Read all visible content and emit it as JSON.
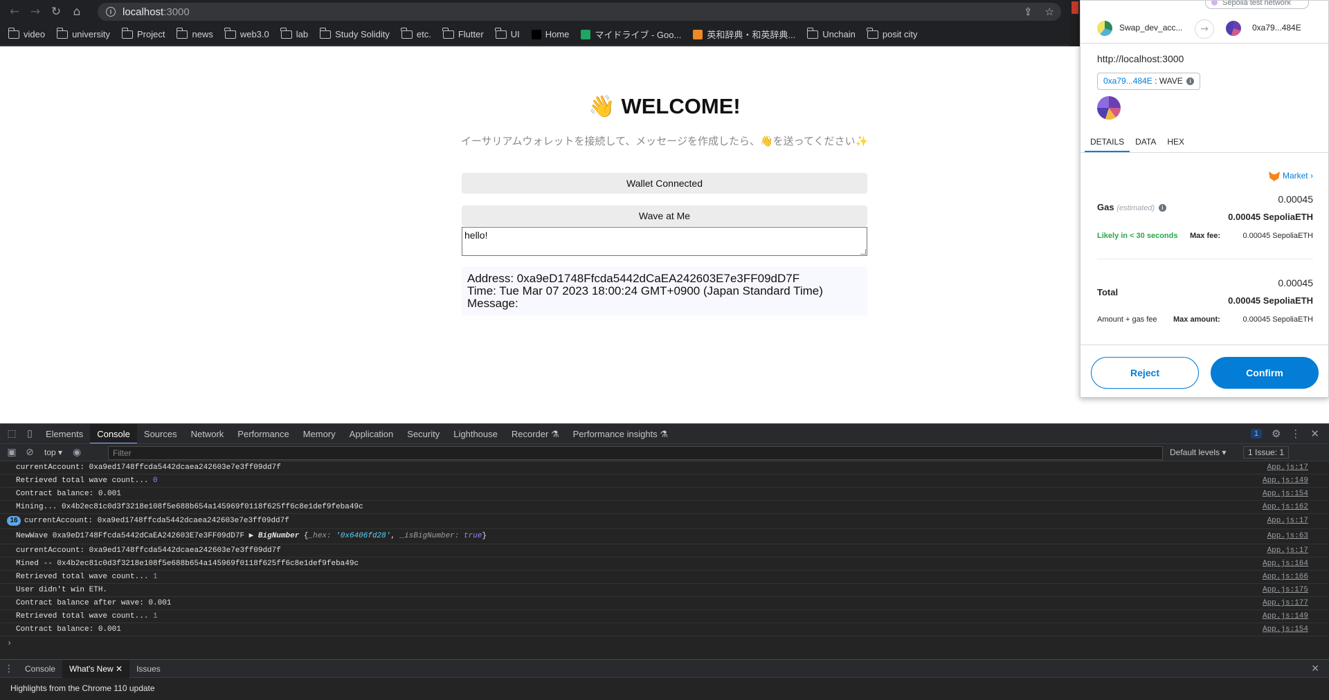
{
  "browser": {
    "url_host": "localhost",
    "url_port": ":3000",
    "bookmarks": [
      {
        "label": "video",
        "type": "folder"
      },
      {
        "label": "university",
        "type": "folder"
      },
      {
        "label": "Project",
        "type": "folder"
      },
      {
        "label": "news",
        "type": "folder"
      },
      {
        "label": "web3.0",
        "type": "folder"
      },
      {
        "label": "lab",
        "type": "folder"
      },
      {
        "label": "Study Solidity",
        "type": "folder"
      },
      {
        "label": "etc.",
        "type": "folder"
      },
      {
        "label": "Flutter",
        "type": "folder"
      },
      {
        "label": "UI",
        "type": "folder"
      },
      {
        "label": "Home",
        "type": "link"
      },
      {
        "label": "マイドライブ - Goo...",
        "type": "link"
      },
      {
        "label": "英和辞典・和英辞典...",
        "type": "link"
      },
      {
        "label": "Unchain",
        "type": "folder"
      },
      {
        "label": "posit city",
        "type": "folder"
      }
    ]
  },
  "page": {
    "welcome": "👋 WELCOME!",
    "subtitle": "イーサリアムウォレットを接続して、メッセージを作成したら、👋を送ってください✨",
    "wallet_button": "Wallet Connected",
    "wave_button": "Wave at Me",
    "message_value": "hello!",
    "wave_card": {
      "address": "Address: 0xa9eD1748Ffcda5442dCaEA242603E7e3FF09dD7F",
      "time": "Time: Tue Mar 07 2023 18:00:24 GMT+0900 (Japan Standard Time)",
      "message": "Message:"
    }
  },
  "devtools": {
    "tabs": [
      "Elements",
      "Console",
      "Sources",
      "Network",
      "Performance",
      "Memory",
      "Application",
      "Security",
      "Lighthouse",
      "Recorder ⚗",
      "Performance insights ⚗"
    ],
    "active_tab": "Console",
    "messages_badge": "1",
    "context": "top ▾",
    "filter_placeholder": "Filter",
    "levels": "Default levels ▾",
    "issues": "1 Issue: 1",
    "logs": [
      {
        "text": "currentAccount:  0xa9ed1748ffcda5442dcaea242603e7e3ff09dd7f",
        "num": "",
        "src": "App.js:17",
        "badge": ""
      },
      {
        "text": "Retrieved total wave count... ",
        "num": "0",
        "src": "App.js:149",
        "badge": ""
      },
      {
        "text": "Contract balance: 0.001",
        "num": "",
        "src": "App.js:154",
        "badge": ""
      },
      {
        "text": "Mining... 0x4b2ec81c0d3f3218e108f5e688b654a145969f0118f625ff6c8e1def9feba49c",
        "num": "",
        "src": "App.js:162",
        "badge": ""
      },
      {
        "text": "currentAccount:  0xa9ed1748ffcda5442dcaea242603e7e3ff09dd7f",
        "num": "",
        "src": "App.js:17",
        "badge": "16"
      },
      {
        "text": "NewWave 0xa9eD1748Ffcda5442dCaEA242603E7e3FF09dD7F ",
        "num": "",
        "src": "App.js:63",
        "badge": "",
        "object": true
      },
      {
        "text": "currentAccount:  0xa9ed1748ffcda5442dcaea242603e7e3ff09dd7f",
        "num": "",
        "src": "App.js:17",
        "badge": ""
      },
      {
        "text": "Mined -- 0x4b2ec81c0d3f3218e108f5e688b654a145969f0118f625ff6c8e1def9feba49c",
        "num": "",
        "src": "App.js:164",
        "badge": ""
      },
      {
        "text": "Retrieved total wave count... ",
        "num": "1",
        "src": "App.js:166",
        "badge": ""
      },
      {
        "text": "User didn't win ETH.",
        "num": "",
        "src": "App.js:175",
        "badge": ""
      },
      {
        "text": "Contract balance after wave: 0.001",
        "num": "",
        "src": "App.js:177",
        "badge": ""
      },
      {
        "text": "Retrieved total wave count... ",
        "num": "1",
        "src": "App.js:149",
        "badge": ""
      },
      {
        "text": "Contract balance: 0.001",
        "num": "",
        "src": "App.js:154",
        "badge": ""
      }
    ],
    "bignumber": {
      "label": "BigNumber",
      "hex_key": "_hex:",
      "hex_val": "'0x6406fd28'",
      "isbn_key": "_isBigNumber:",
      "isbn_val": "true"
    },
    "drawer_tabs": [
      "Console",
      "What's New",
      "Issues"
    ],
    "drawer_active": "What's New",
    "drawer_body": "Highlights from the Chrome 110 update"
  },
  "metamask": {
    "network": "Sepolia test network",
    "from_account": "Swap_dev_acc...",
    "to_account": "0xa79...484E",
    "origin": "http://localhost:3000",
    "contract_addr": "0xa79...484E",
    "contract_sep": " : WAVE",
    "tabs": [
      "DETAILS",
      "DATA",
      "HEX"
    ],
    "active_tab": "DETAILS",
    "market": "Market",
    "gas_label": "Gas",
    "gas_est": "(estimated)",
    "gas_small": "0.00045",
    "gas_bold": "0.00045 SepoliaETH",
    "likely": "Likely in < 30 seconds",
    "max_fee_label": "Max fee:",
    "max_fee_val": "0.00045 SepoliaETH",
    "total_label": "Total",
    "total_small": "0.00045",
    "total_bold": "0.00045 SepoliaETH",
    "amount_gas": "Amount + gas fee",
    "max_amount_label": "Max amount:",
    "max_amount_val": "0.00045 SepoliaETH",
    "reject": "Reject",
    "confirm": "Confirm",
    "colors": {
      "accent": "#037dd6",
      "success": "#28a745"
    }
  }
}
